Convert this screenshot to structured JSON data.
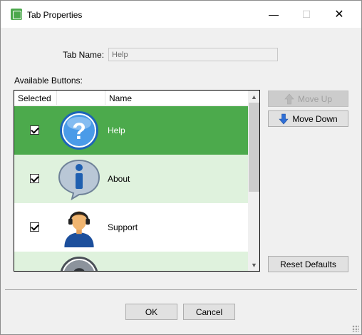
{
  "window": {
    "title": "Tab Properties",
    "controls": {
      "minimize": "—",
      "maximize": "☐",
      "close": "✕"
    }
  },
  "form": {
    "tab_name_label": "Tab Name:",
    "tab_name_value": "Help",
    "available_label": "Available Buttons:"
  },
  "list": {
    "columns": {
      "selected": "Selected",
      "icon": "",
      "name": "Name"
    },
    "rows": [
      {
        "name": "Help",
        "selected": true,
        "icon": "question-bubble-icon",
        "bg": "#4caa4c"
      },
      {
        "name": "About",
        "selected": true,
        "icon": "info-bubble-icon",
        "bg": "#dff2dd"
      },
      {
        "name": "Support",
        "selected": true,
        "icon": "support-agent-icon",
        "bg": "#ffffff"
      },
      {
        "name": "",
        "selected": false,
        "icon": "question-bubble-gray-icon",
        "bg": "#dff2dd"
      }
    ]
  },
  "buttons": {
    "move_up": "Move Up",
    "move_down": "Move Down",
    "reset_defaults": "Reset Defaults",
    "ok": "OK",
    "cancel": "Cancel"
  },
  "colors": {
    "selected_row": "#4caa4c",
    "alt_row": "#dff2dd",
    "arrow_blue": "#2f6fd6"
  }
}
